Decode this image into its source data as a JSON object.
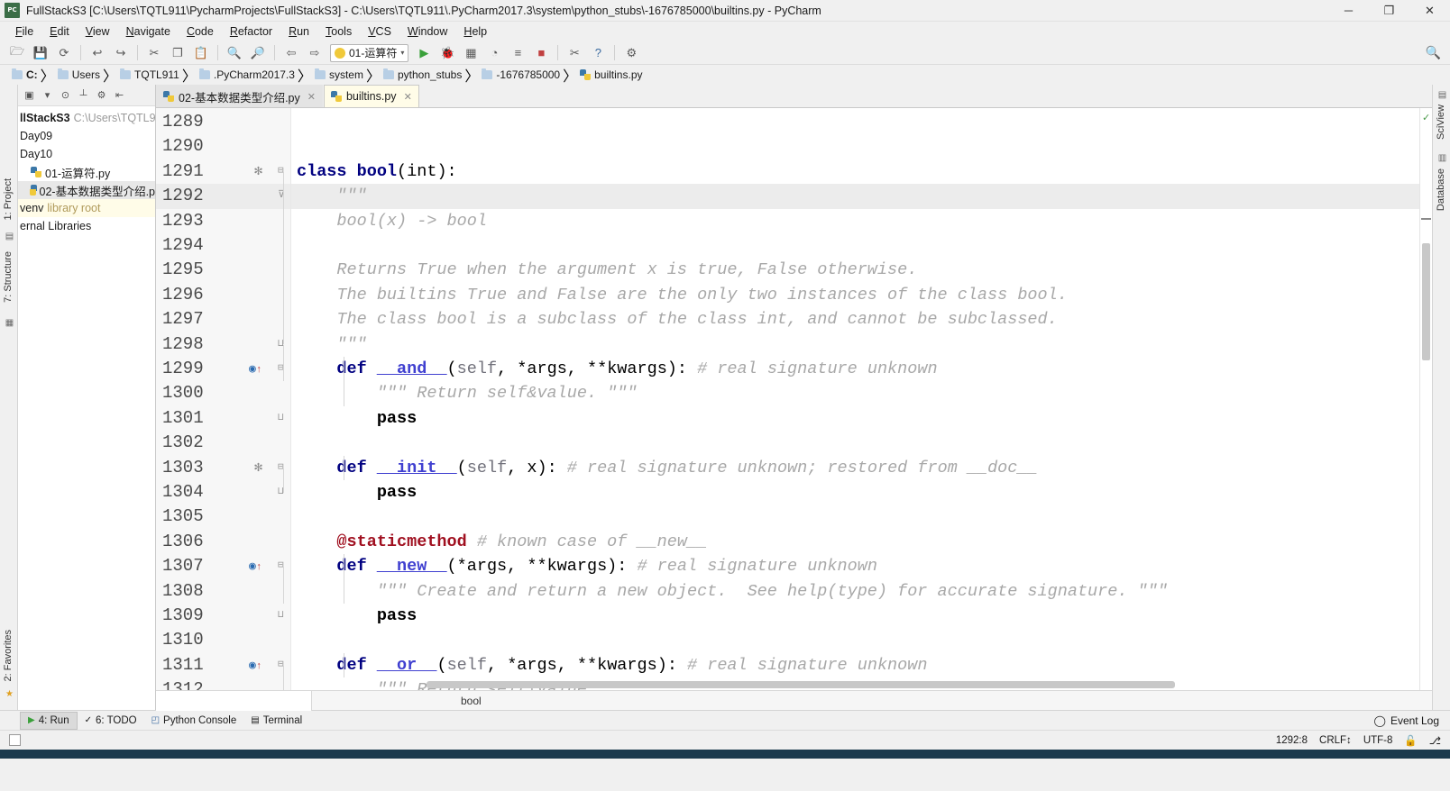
{
  "window": {
    "title": "FullStackS3 [C:\\Users\\TQTL911\\PycharmProjects\\FullStackS3] - C:\\Users\\TQTL911\\.PyCharm2017.3\\system\\python_stubs\\-1676785000\\builtins.py - PyCharm",
    "app_icon": "pycharm-icon",
    "minimize": "─",
    "maximize": "❐",
    "close": "✕"
  },
  "menubar": {
    "items": [
      {
        "label": "File"
      },
      {
        "label": "Edit"
      },
      {
        "label": "View"
      },
      {
        "label": "Navigate"
      },
      {
        "label": "Code"
      },
      {
        "label": "Refactor"
      },
      {
        "label": "Run"
      },
      {
        "label": "Tools"
      },
      {
        "label": "VCS"
      },
      {
        "label": "Window"
      },
      {
        "label": "Help"
      }
    ]
  },
  "toolbar": {
    "icons": [
      {
        "name": "open-folder-icon",
        "glyph": "🗁"
      },
      {
        "name": "save-all-icon",
        "glyph": "💾"
      },
      {
        "name": "sync-icon",
        "glyph": "⟳"
      },
      {
        "name": "undo-icon",
        "glyph": "↩"
      },
      {
        "name": "redo-icon",
        "glyph": "↪"
      },
      {
        "name": "cut-icon",
        "glyph": "✂"
      },
      {
        "name": "copy-icon",
        "glyph": "❐"
      },
      {
        "name": "paste-icon",
        "glyph": "📋"
      },
      {
        "name": "find-icon",
        "glyph": "🔍"
      },
      {
        "name": "replace-icon",
        "glyph": "🔎"
      },
      {
        "name": "back-icon",
        "glyph": "⇦"
      },
      {
        "name": "forward-icon",
        "glyph": "⇨"
      }
    ],
    "run_config": {
      "label": "01-运算符",
      "chevron": "▾",
      "icon": "python-config-icon"
    },
    "run_icons": [
      {
        "name": "run-icon",
        "glyph": "▶"
      },
      {
        "name": "debug-icon",
        "glyph": "🐞"
      },
      {
        "name": "coverage-icon",
        "glyph": "▦"
      },
      {
        "name": "profile-icon",
        "glyph": "◔"
      },
      {
        "name": "run-with-console-icon",
        "glyph": "≡"
      },
      {
        "name": "stop-icon",
        "glyph": "■"
      },
      {
        "name": "vcs-update-icon",
        "glyph": "✂"
      },
      {
        "name": "help-icon",
        "glyph": "?"
      },
      {
        "name": "settings-icon",
        "glyph": "⚙"
      }
    ],
    "search_icon": "🔍"
  },
  "breadcrumbs": {
    "separator": "〉",
    "items": [
      {
        "label": "C:",
        "icon": "folder-icon"
      },
      {
        "label": "Users",
        "icon": "folder-icon"
      },
      {
        "label": "TQTL911",
        "icon": "folder-icon"
      },
      {
        "label": ".PyCharm2017.3",
        "icon": "folder-icon"
      },
      {
        "label": "system",
        "icon": "folder-icon"
      },
      {
        "label": "python_stubs",
        "icon": "folder-icon"
      },
      {
        "label": "-1676785000",
        "icon": "folder-icon"
      },
      {
        "label": "builtins.py",
        "icon": "python-file-icon"
      }
    ]
  },
  "left_rail": {
    "project_label": "1: Project",
    "structure_label": "7: Structure",
    "favorites_label": "2: Favorites",
    "icons": [
      "grid-icon",
      "star-icon"
    ]
  },
  "right_rail": {
    "sciview_label": "SciView",
    "database_label": "Database",
    "icons": [
      "grid-icon",
      "database-icon"
    ]
  },
  "project_panel": {
    "toolbar_icons": [
      {
        "name": "select-opened-file-icon",
        "glyph": "▣"
      },
      {
        "name": "chevron-down-icon",
        "glyph": "▾"
      },
      {
        "name": "scroll-from-source-icon",
        "glyph": "⊙"
      },
      {
        "name": "collapse-all-icon",
        "glyph": "┴"
      },
      {
        "name": "settings-gear-icon",
        "glyph": "⚙"
      },
      {
        "name": "hide-icon",
        "glyph": "⇤"
      }
    ],
    "tree": [
      {
        "label": "llStackS3",
        "suffix": "C:\\Users\\TQTL9",
        "kind": "root",
        "selected": false
      },
      {
        "label": "Day09",
        "suffix": "",
        "kind": "folder",
        "selected": false
      },
      {
        "label": "Day10",
        "suffix": "",
        "kind": "folder",
        "selected": false
      },
      {
        "label": "01-运算符.py",
        "suffix": "",
        "kind": "python",
        "selected": false
      },
      {
        "label": "02-基本数据类型介绍.p",
        "suffix": "",
        "kind": "python",
        "selected": true
      },
      {
        "label": "venv",
        "suffix": "library root",
        "kind": "libroot",
        "selected": false
      },
      {
        "label": "ernal Libraries",
        "suffix": "",
        "kind": "folder",
        "selected": false
      }
    ]
  },
  "editor_tabs": [
    {
      "label": "02-基本数据类型介绍.py",
      "icon": "python-file-icon",
      "active": false,
      "close": "✕"
    },
    {
      "label": "builtins.py",
      "icon": "python-file-icon",
      "active": true,
      "close": "✕"
    }
  ],
  "editor": {
    "first_line": 1289,
    "highlighted_line": 1292,
    "lines": [
      {
        "num": 1289,
        "marker": "",
        "fold": "",
        "tokens": []
      },
      {
        "num": 1290,
        "marker": "",
        "fold": "",
        "tokens": []
      },
      {
        "num": 1291,
        "marker": "star",
        "fold": "open",
        "tokens": [
          {
            "t": "class ",
            "c": "kw"
          },
          {
            "t": "bool",
            "c": "cls"
          },
          {
            "t": "(int):",
            "c": "plain"
          }
        ]
      },
      {
        "num": 1292,
        "marker": "",
        "fold": "tail",
        "tokens": [
          {
            "t": "    \"\"\"",
            "c": "doc"
          }
        ]
      },
      {
        "num": 1293,
        "marker": "",
        "fold": "",
        "tokens": [
          {
            "t": "    bool(x) -> bool",
            "c": "doc"
          }
        ]
      },
      {
        "num": 1294,
        "marker": "",
        "fold": "",
        "tokens": []
      },
      {
        "num": 1295,
        "marker": "",
        "fold": "",
        "tokens": [
          {
            "t": "    Returns True when the argument x is true, False otherwise.",
            "c": "doc"
          }
        ]
      },
      {
        "num": 1296,
        "marker": "",
        "fold": "",
        "tokens": [
          {
            "t": "    The builtins True and False are the only two instances of the class bool.",
            "c": "doc"
          }
        ]
      },
      {
        "num": 1297,
        "marker": "",
        "fold": "",
        "tokens": [
          {
            "t": "    The class bool is a subclass of the class int, and cannot be subclassed.",
            "c": "doc"
          }
        ]
      },
      {
        "num": 1298,
        "marker": "",
        "fold": "close",
        "tokens": [
          {
            "t": "    \"\"\"",
            "c": "doc"
          }
        ]
      },
      {
        "num": 1299,
        "marker": "override",
        "fold": "open",
        "tokens": [
          {
            "t": "    def ",
            "c": "kw"
          },
          {
            "t": "__and__",
            "c": "fn"
          },
          {
            "t": "(",
            "c": "plain"
          },
          {
            "t": "self",
            "c": "param"
          },
          {
            "t": ", *args, **kwargs):",
            "c": "plain"
          },
          {
            "t": " # real signature unknown",
            "c": "cmt"
          }
        ]
      },
      {
        "num": 1300,
        "marker": "",
        "fold": "",
        "tokens": [
          {
            "t": "        \"\"\" Return self&value. \"\"\"",
            "c": "doc"
          }
        ]
      },
      {
        "num": 1301,
        "marker": "",
        "fold": "close",
        "tokens": [
          {
            "t": "        pass",
            "c": "bold"
          }
        ]
      },
      {
        "num": 1302,
        "marker": "",
        "fold": "",
        "tokens": []
      },
      {
        "num": 1303,
        "marker": "star",
        "fold": "open",
        "tokens": [
          {
            "t": "    def ",
            "c": "kw"
          },
          {
            "t": "__init__",
            "c": "fn"
          },
          {
            "t": "(",
            "c": "plain"
          },
          {
            "t": "self",
            "c": "param"
          },
          {
            "t": ", x):",
            "c": "plain"
          },
          {
            "t": " # real signature unknown; restored from __doc__",
            "c": "cmt"
          }
        ]
      },
      {
        "num": 1304,
        "marker": "",
        "fold": "close",
        "tokens": [
          {
            "t": "        pass",
            "c": "bold"
          }
        ]
      },
      {
        "num": 1305,
        "marker": "",
        "fold": "",
        "tokens": []
      },
      {
        "num": 1306,
        "marker": "",
        "fold": "",
        "tokens": [
          {
            "t": "    @staticmethod",
            "c": "dec"
          },
          {
            "t": " # known case of __new__",
            "c": "cmt"
          }
        ]
      },
      {
        "num": 1307,
        "marker": "override",
        "fold": "open",
        "tokens": [
          {
            "t": "    def ",
            "c": "kw"
          },
          {
            "t": "__new__",
            "c": "fn"
          },
          {
            "t": "(*args, **kwargs):",
            "c": "plain"
          },
          {
            "t": " # real signature unknown",
            "c": "cmt"
          }
        ]
      },
      {
        "num": 1308,
        "marker": "",
        "fold": "",
        "tokens": [
          {
            "t": "        \"\"\" Create and return a new object.  See help(type) for accurate signature. \"\"\"",
            "c": "doc"
          }
        ]
      },
      {
        "num": 1309,
        "marker": "",
        "fold": "close",
        "tokens": [
          {
            "t": "        pass",
            "c": "bold"
          }
        ]
      },
      {
        "num": 1310,
        "marker": "",
        "fold": "",
        "tokens": []
      },
      {
        "num": 1311,
        "marker": "override",
        "fold": "open",
        "tokens": [
          {
            "t": "    def ",
            "c": "kw"
          },
          {
            "t": "__or__",
            "c": "fn"
          },
          {
            "t": "(",
            "c": "plain"
          },
          {
            "t": "self",
            "c": "param"
          },
          {
            "t": ", *args, **kwargs):",
            "c": "plain"
          },
          {
            "t": " # real signature unknown",
            "c": "cmt"
          }
        ]
      },
      {
        "num": 1312,
        "marker": "",
        "fold": "",
        "tokens": [
          {
            "t": "        \"\"\" Return self|value. \"\"\"",
            "c": "doc"
          }
        ]
      }
    ],
    "marker_check": "✓",
    "status_crumb": "bool"
  },
  "bottom_bar": {
    "items": [
      {
        "label": "4: Run",
        "icon": "run-icon",
        "glyph": "▶",
        "active": true
      },
      {
        "label": "6: TODO",
        "icon": "todo-icon",
        "glyph": "✓",
        "active": false
      },
      {
        "label": "Python Console",
        "icon": "python-console-icon",
        "glyph": "◰",
        "active": false
      },
      {
        "label": "Terminal",
        "icon": "terminal-icon",
        "glyph": "▤",
        "active": false
      }
    ],
    "event_log": {
      "label": "Event Log",
      "icon": "speech-bubble-icon",
      "glyph": "◯"
    }
  },
  "statusbar": {
    "caret_position": "1292:8",
    "line_separator": "CRLF↕",
    "encoding": "UTF-8",
    "lock_icon": "🔓",
    "branch_icon": "⎇"
  }
}
